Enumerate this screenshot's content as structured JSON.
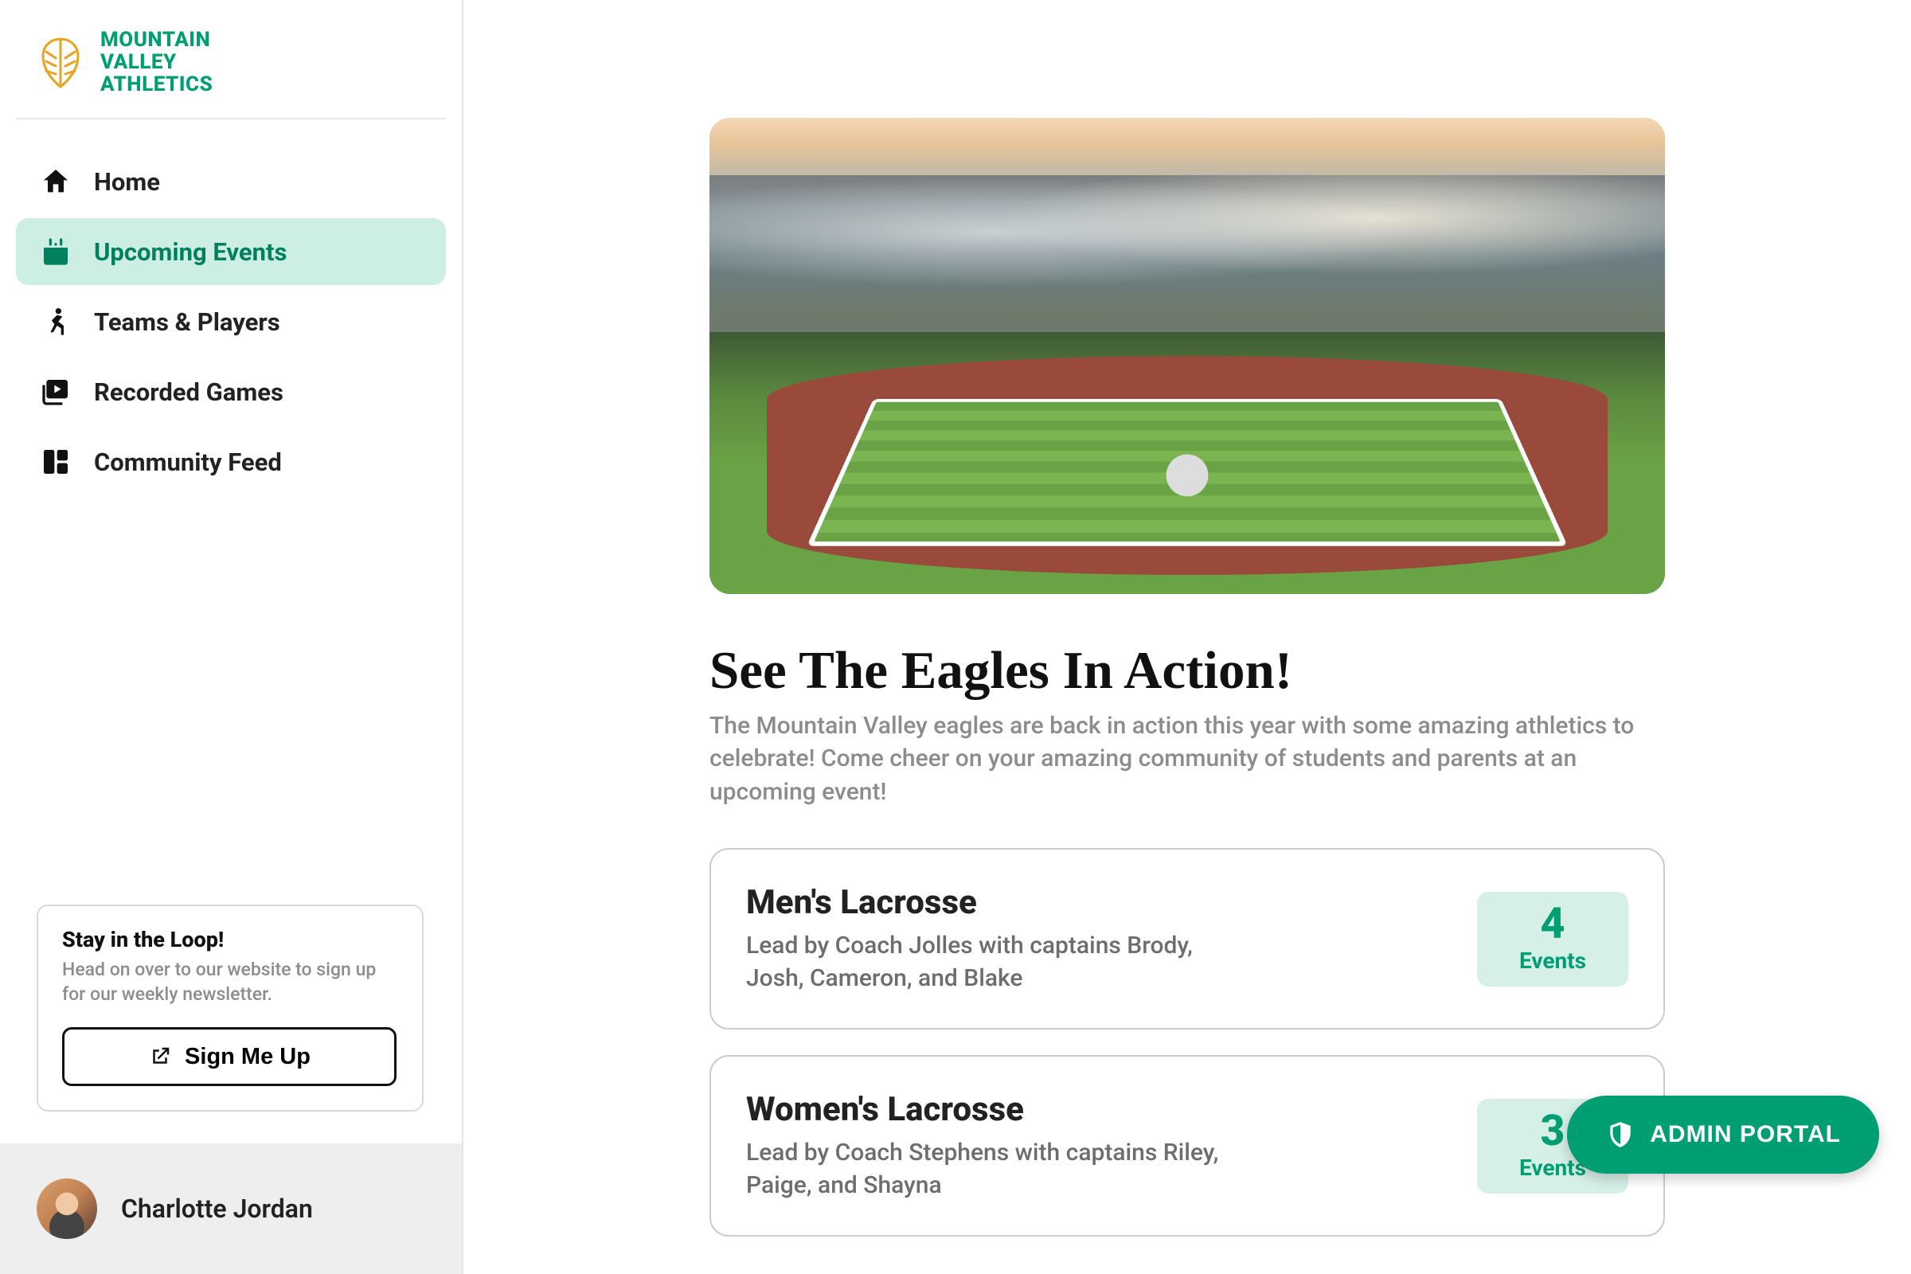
{
  "brand": {
    "line1": "MOUNTAIN",
    "line2": "VALLEY",
    "line3": "ATHLETICS"
  },
  "sidebar": {
    "items": [
      {
        "label": "Home",
        "icon": "home-icon",
        "active": false
      },
      {
        "label": "Upcoming Events",
        "icon": "calendar-icon",
        "active": true
      },
      {
        "label": "Teams & Players",
        "icon": "runner-icon",
        "active": false
      },
      {
        "label": "Recorded Games",
        "icon": "video-library-icon",
        "active": false
      },
      {
        "label": "Community Feed",
        "icon": "dashboard-icon",
        "active": false
      }
    ]
  },
  "loop": {
    "title": "Stay in the Loop!",
    "subtitle": "Head on over to our website to sign up for our weekly newsletter.",
    "button": "Sign Me Up"
  },
  "user": {
    "name": "Charlotte Jordan"
  },
  "page": {
    "title": "See The Eagles In Action!",
    "subtitle": "The Mountain Valley eagles are back in action this year with some amazing athletics to celebrate! Come cheer on your amazing community of students and parents at an upcoming event!"
  },
  "events_label": "Events",
  "events": [
    {
      "title": "Men's Lacrosse",
      "subtitle": "Lead by Coach Jolles with captains Brody, Josh, Cameron, and Blake",
      "count": "4"
    },
    {
      "title": "Women's Lacrosse",
      "subtitle": "Lead by Coach Stephens with captains Riley, Paige, and Shayna",
      "count": "3"
    }
  ],
  "admin_portal": "ADMIN PORTAL"
}
